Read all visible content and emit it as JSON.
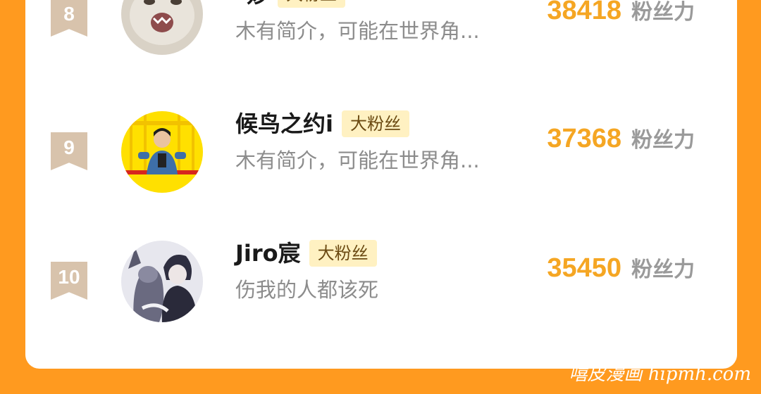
{
  "ranking": {
    "entries": [
      {
        "rank": "8",
        "name": "–妙",
        "badge": "大粉丝",
        "bio": "木有简介，可能在世界角...",
        "score": "38418",
        "score_unit": "粉丝力",
        "avatar_icon": "cat-avatar"
      },
      {
        "rank": "9",
        "name": "候鸟之约i",
        "badge": "大粉丝",
        "bio": "木有简介，可能在世界角...",
        "score": "37368",
        "score_unit": "粉丝力",
        "avatar_icon": "person-avatar"
      },
      {
        "rank": "10",
        "name": "Jiro宸",
        "badge": "大粉丝",
        "bio": "伤我的人都该死",
        "score": "35450",
        "score_unit": "粉丝力",
        "avatar_icon": "anime-characters-avatar"
      }
    ]
  },
  "watermark": "嘻皮漫画 hipmh.com",
  "colors": {
    "background": "#FF9A1F",
    "panel": "#FFFFFF",
    "score": "#F5A623",
    "badge_bg": "#FFF1C2",
    "rank_bg": "#D8C3AC"
  }
}
